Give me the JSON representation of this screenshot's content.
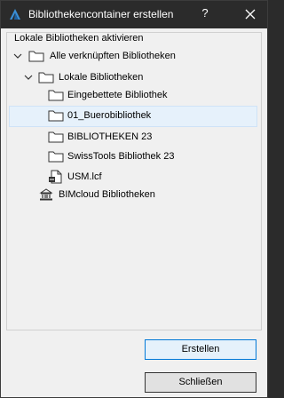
{
  "window": {
    "title": "Bibliothekencontainer erstellen",
    "help_label": "?",
    "app_icon": "archicad-logo-icon",
    "close_icon": "close-icon"
  },
  "group": {
    "label": "Lokale Bibliotheken aktivieren"
  },
  "tree": {
    "items": [
      {
        "label": "Alle verknüpften Bibliotheken",
        "icon": "folder-icon",
        "expander": "expanded",
        "level": 0,
        "selected": false
      },
      {
        "label": "Lokale Bibliotheken",
        "icon": "folder-icon",
        "expander": "expanded",
        "level": 1,
        "selected": false
      },
      {
        "label": "Eingebettete Bibliothek",
        "icon": "folder-icon",
        "expander": "none",
        "level": 2,
        "selected": false
      },
      {
        "label": "01_Buerobibliothek",
        "icon": "folder-icon",
        "expander": "none",
        "level": 2,
        "selected": true
      },
      {
        "label": "BIBLIOTHEKEN 23",
        "icon": "folder-icon",
        "expander": "none",
        "level": 2,
        "selected": false
      },
      {
        "label": "SwissTools Bibliothek 23",
        "icon": "folder-icon",
        "expander": "none",
        "level": 2,
        "selected": false
      },
      {
        "label": "USM.lcf",
        "icon": "library-container-file-icon",
        "expander": "none",
        "level": 2,
        "selected": false
      },
      {
        "label": "BIMcloud Bibliotheken",
        "icon": "bimcloud-icon",
        "expander": "none",
        "level": 1,
        "selected": false
      }
    ]
  },
  "buttons": {
    "create_label": "Erstellen",
    "close_label": "Schließen"
  },
  "colors": {
    "titlebar": "#2b2b2b",
    "selection": "#e6f1fb",
    "default_button_border": "#0078d7"
  }
}
